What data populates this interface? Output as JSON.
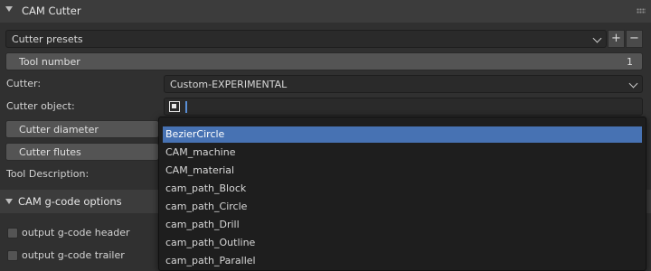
{
  "panel": {
    "title": "CAM Cutter"
  },
  "presets": {
    "value": "Cutter presets",
    "add": "+",
    "remove": "−"
  },
  "tool_number": {
    "label": "Tool number",
    "value": "1"
  },
  "cutter": {
    "label": "Cutter:",
    "value": "Custom-EXPERIMENTAL"
  },
  "cutter_object": {
    "label": "Cutter object:"
  },
  "cutter_diameter": {
    "label": "Cutter diameter"
  },
  "cutter_flutes": {
    "label": "Cutter flutes"
  },
  "tool_description": {
    "label": "Tool Description:"
  },
  "gcode_section": {
    "title": "CAM g-code options"
  },
  "options": {
    "header": "output g-code header",
    "trailer": "output g-code trailer"
  },
  "dropdown": {
    "items": [
      "BezierCircle",
      "CAM_machine",
      "CAM_material",
      "cam_path_Block",
      "cam_path_Circle",
      "cam_path_Drill",
      "cam_path_Outline",
      "cam_path_Parallel"
    ],
    "selected": "BezierCircle"
  },
  "colors": {
    "background": "#303030",
    "header": "#3c3c3c",
    "button": "#545454",
    "selection": "#4772b3",
    "caret": "#5a8fd6"
  },
  "icons": [
    "expand-arrow-icon",
    "drag-grip-icon",
    "chevron-down-icon",
    "object-icon"
  ]
}
